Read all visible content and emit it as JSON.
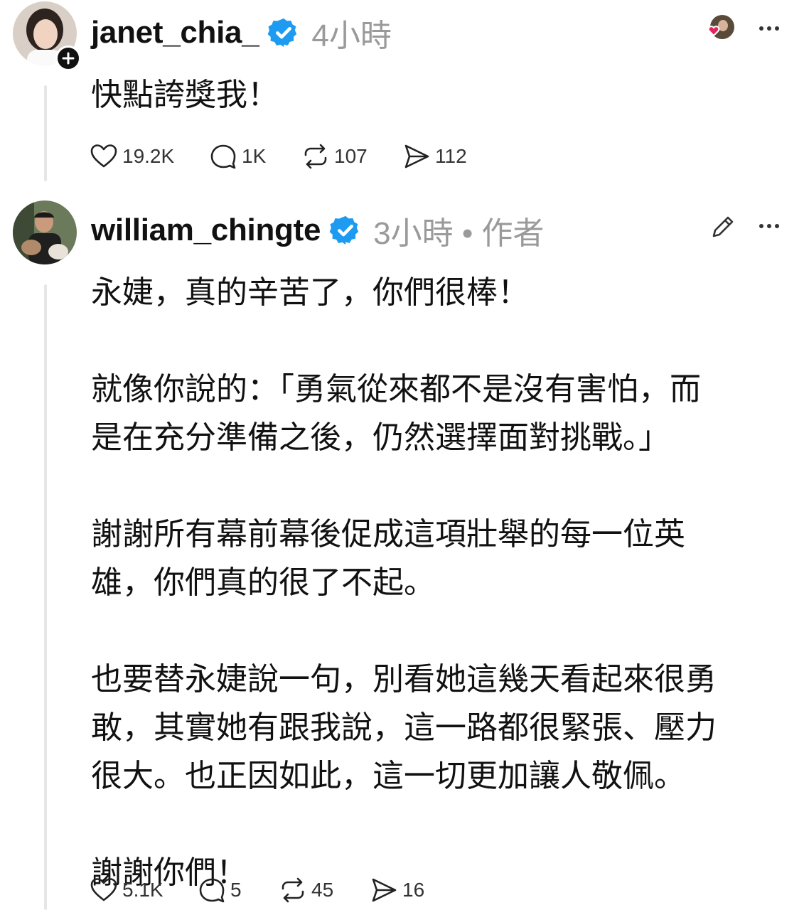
{
  "posts": [
    {
      "username": "janet_chia_",
      "time": "4小時",
      "text": "快點誇獎我！",
      "stats": {
        "likes": "19.2K",
        "replies": "1K",
        "reposts": "107",
        "shares": "112"
      }
    },
    {
      "username": "william_chingte",
      "time": "3小時 • 作者",
      "text": "永婕，真的辛苦了，你們很棒！\n\n就像你說的：「勇氣從來都不是沒有害怕，而\n是在充分準備之後，仍然選擇面對挑戰。」\n\n謝謝所有幕前幕後促成這項壯舉的每一位英\n雄，你們真的很了不起。\n\n也要替永婕說一句，別看她這幾天看起來很勇\n敢，其實她有跟我說，這一路都很緊張、壓力\n很大。也正因如此，這一切更加讓人敬佩。\n\n謝謝你們！",
      "stats": {
        "likes": "5.1K",
        "replies": "5",
        "reposts": "45",
        "shares": "16"
      }
    }
  ],
  "icons": {
    "verified": "verified-badge-icon",
    "like": "heart-icon",
    "reply": "comment-icon",
    "repost": "repost-icon",
    "share": "send-icon",
    "more": "more-icon",
    "edit": "pencil-icon",
    "follow": "plus-icon"
  },
  "colors": {
    "verified": "#1d9bf0",
    "muted": "#9a9a9a",
    "like_heart": "#e0245e"
  }
}
